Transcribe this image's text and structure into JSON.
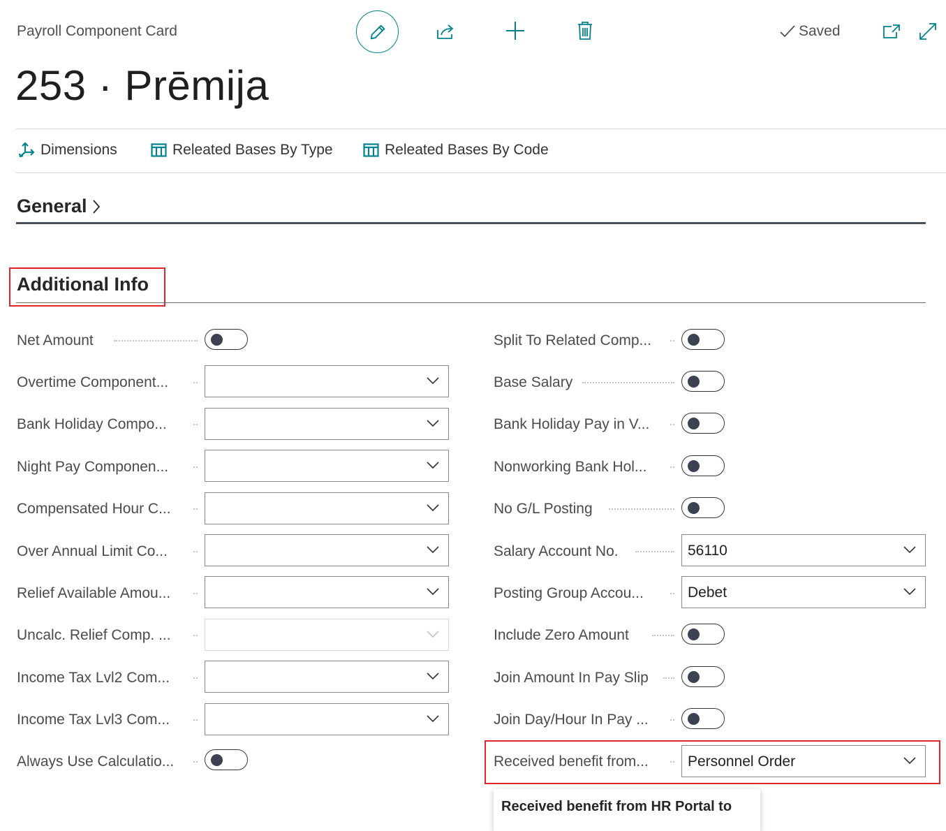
{
  "header": {
    "page_caption": "Payroll Component Card",
    "title": "253 · Prēmija",
    "saved_label": "Saved",
    "accent_color": "#00838f"
  },
  "actions": [
    {
      "label": "Dimensions",
      "icon": "dimensions-icon"
    },
    {
      "label": "Releated Bases By Type",
      "icon": "table-icon"
    },
    {
      "label": "Releated Bases By Code",
      "icon": "table-icon"
    }
  ],
  "sections": {
    "general": "General",
    "additional_info": "Additional Info"
  },
  "left_fields": [
    {
      "label": "Net Amount",
      "type": "toggle",
      "value": false
    },
    {
      "label": "Overtime Component...",
      "type": "dropdown",
      "value": ""
    },
    {
      "label": "Bank Holiday Compo...",
      "type": "dropdown",
      "value": ""
    },
    {
      "label": "Night Pay Componen...",
      "type": "dropdown",
      "value": ""
    },
    {
      "label": "Compensated Hour C...",
      "type": "dropdown",
      "value": ""
    },
    {
      "label": "Over Annual Limit Co...",
      "type": "dropdown",
      "value": ""
    },
    {
      "label": "Relief Available Amou...",
      "type": "dropdown",
      "value": ""
    },
    {
      "label": "Uncalc. Relief Comp. ...",
      "type": "dropdown",
      "value": "",
      "disabled": true
    },
    {
      "label": "Income Tax Lvl2 Com...",
      "type": "dropdown",
      "value": ""
    },
    {
      "label": "Income Tax Lvl3 Com...",
      "type": "dropdown",
      "value": ""
    },
    {
      "label": "Always Use Calculatio...",
      "type": "toggle",
      "value": false
    }
  ],
  "right_fields": [
    {
      "label": "Split To Related Comp...",
      "type": "toggle",
      "value": false
    },
    {
      "label": "Base Salary",
      "type": "toggle",
      "value": false
    },
    {
      "label": "Bank Holiday Pay in V...",
      "type": "toggle",
      "value": false
    },
    {
      "label": "Nonworking Bank Hol...",
      "type": "toggle",
      "value": false
    },
    {
      "label": "No G/L Posting",
      "type": "toggle",
      "value": false
    },
    {
      "label": "Salary Account No.",
      "type": "dropdown",
      "value": "56110"
    },
    {
      "label": "Posting Group Accou...",
      "type": "dropdown",
      "value": "Debet"
    },
    {
      "label": "Include Zero Amount",
      "type": "toggle",
      "value": false
    },
    {
      "label": "Join Amount In Pay Slip",
      "type": "toggle",
      "value": false
    },
    {
      "label": "Join Day/Hour In Pay ...",
      "type": "toggle",
      "value": false
    },
    {
      "label": "Received benefit from...",
      "type": "dropdown",
      "value": "Personnel Order"
    }
  ],
  "tooltip": "Received benefit from HR Portal to"
}
